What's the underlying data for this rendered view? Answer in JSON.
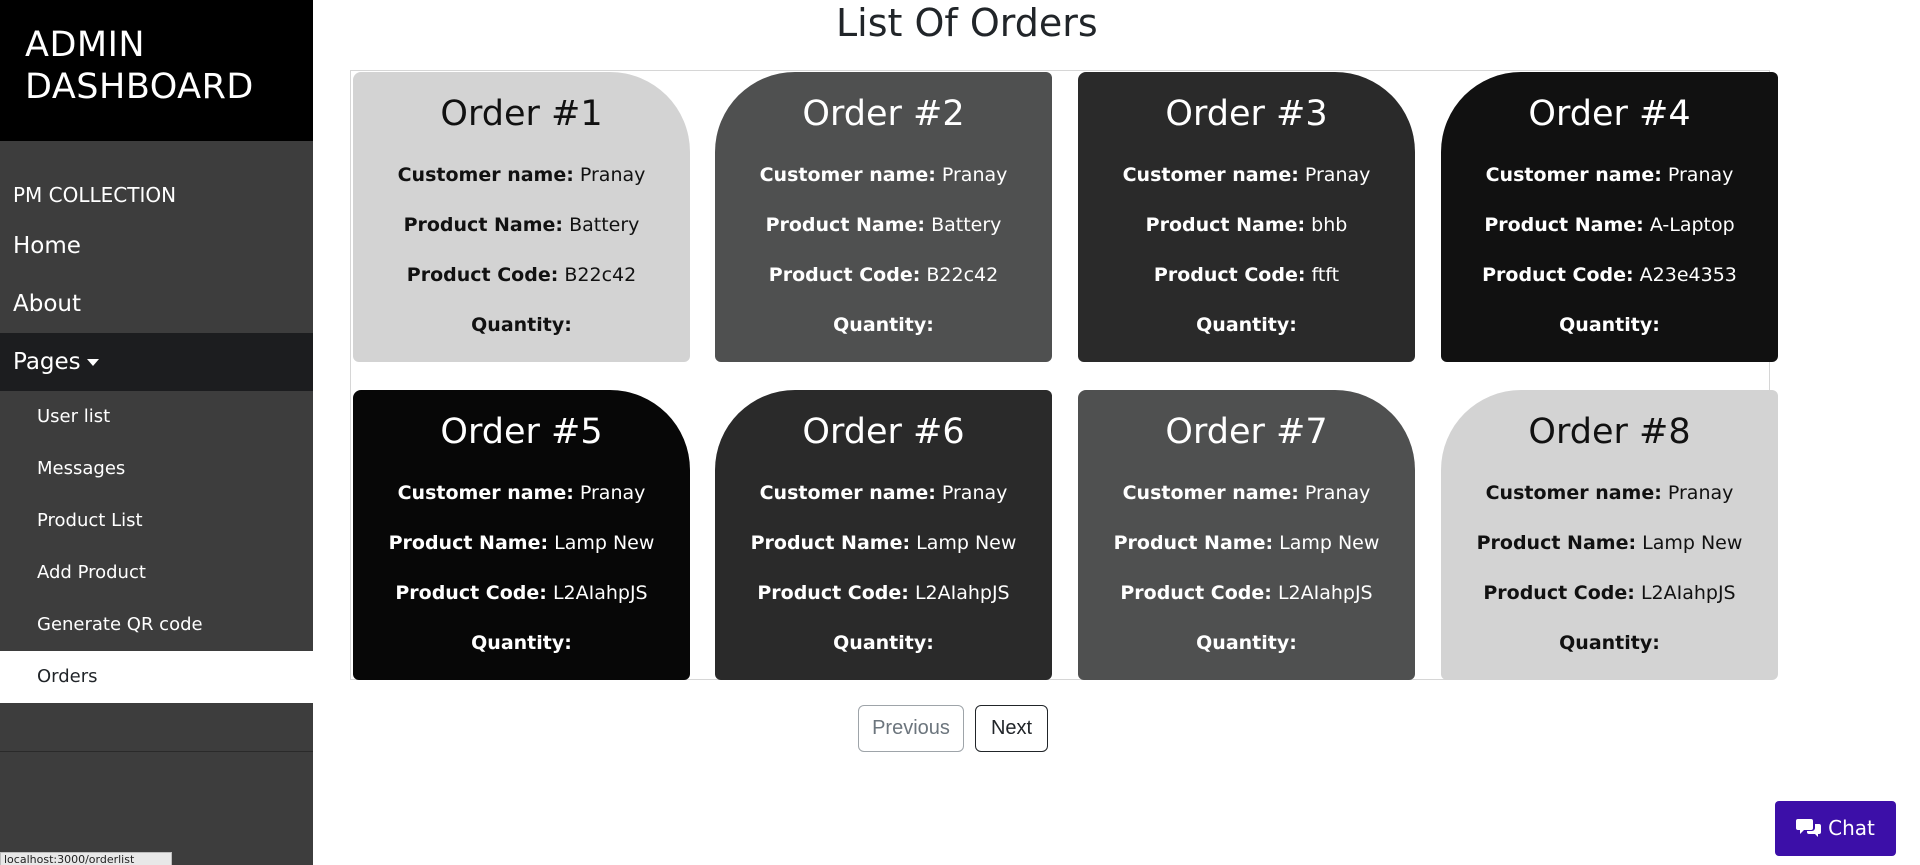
{
  "sidebar": {
    "brand": "ADMIN DASHBOARD",
    "subbrand": "PM COLLECTION",
    "nav": {
      "home": "Home",
      "about": "About",
      "pages": "Pages"
    },
    "pages_menu": [
      "User list",
      "Messages",
      "Product List",
      "Add Product",
      "Generate QR code",
      "Orders"
    ],
    "selected_item": "Orders"
  },
  "status_bar": {
    "url": "localhost:3000/orderlist"
  },
  "main": {
    "title": "List Of Orders",
    "labels": {
      "customer": "Customer name:",
      "product_name": "Product Name:",
      "product_code": "Product Code:",
      "quantity": "Quantity:"
    },
    "orders": [
      {
        "title": "Order #1",
        "customer": "Pranay",
        "product_name": "Battery",
        "product_code": "B22c42",
        "quantity": "",
        "theme": "light",
        "bg": "#d3d3d3"
      },
      {
        "title": "Order #2",
        "customer": "Pranay",
        "product_name": "Battery",
        "product_code": "B22c42",
        "quantity": "",
        "theme": "mid",
        "bg": "#4f5050"
      },
      {
        "title": "Order #3",
        "customer": "Pranay",
        "product_name": "bhb",
        "product_code": "ftft",
        "quantity": "",
        "theme": "dark",
        "bg": "#2a2a2a"
      },
      {
        "title": "Order #4",
        "customer": "Pranay",
        "product_name": "A-Laptop",
        "product_code": "A23e4353",
        "quantity": "",
        "theme": "darker",
        "bg": "#111111"
      },
      {
        "title": "Order #5",
        "customer": "Pranay",
        "product_name": "Lamp New",
        "product_code": "L2AIahpJS",
        "quantity": "",
        "theme": "black",
        "bg": "#070707"
      },
      {
        "title": "Order #6",
        "customer": "Pranay",
        "product_name": "Lamp New",
        "product_code": "L2AIahpJS",
        "quantity": "",
        "theme": "dark",
        "bg": "#2a2a2a"
      },
      {
        "title": "Order #7",
        "customer": "Pranay",
        "product_name": "Lamp New",
        "product_code": "L2AIahpJS",
        "quantity": "",
        "theme": "mid",
        "bg": "#4f5050"
      },
      {
        "title": "Order #8",
        "customer": "Pranay",
        "product_name": "Lamp New",
        "product_code": "L2AIahpJS",
        "quantity": "",
        "theme": "light",
        "bg": "#d3d3d3"
      }
    ]
  },
  "pagination": {
    "previous": "Previous",
    "next": "Next"
  },
  "chat": {
    "label": "Chat",
    "color": "#3c0fa8"
  }
}
